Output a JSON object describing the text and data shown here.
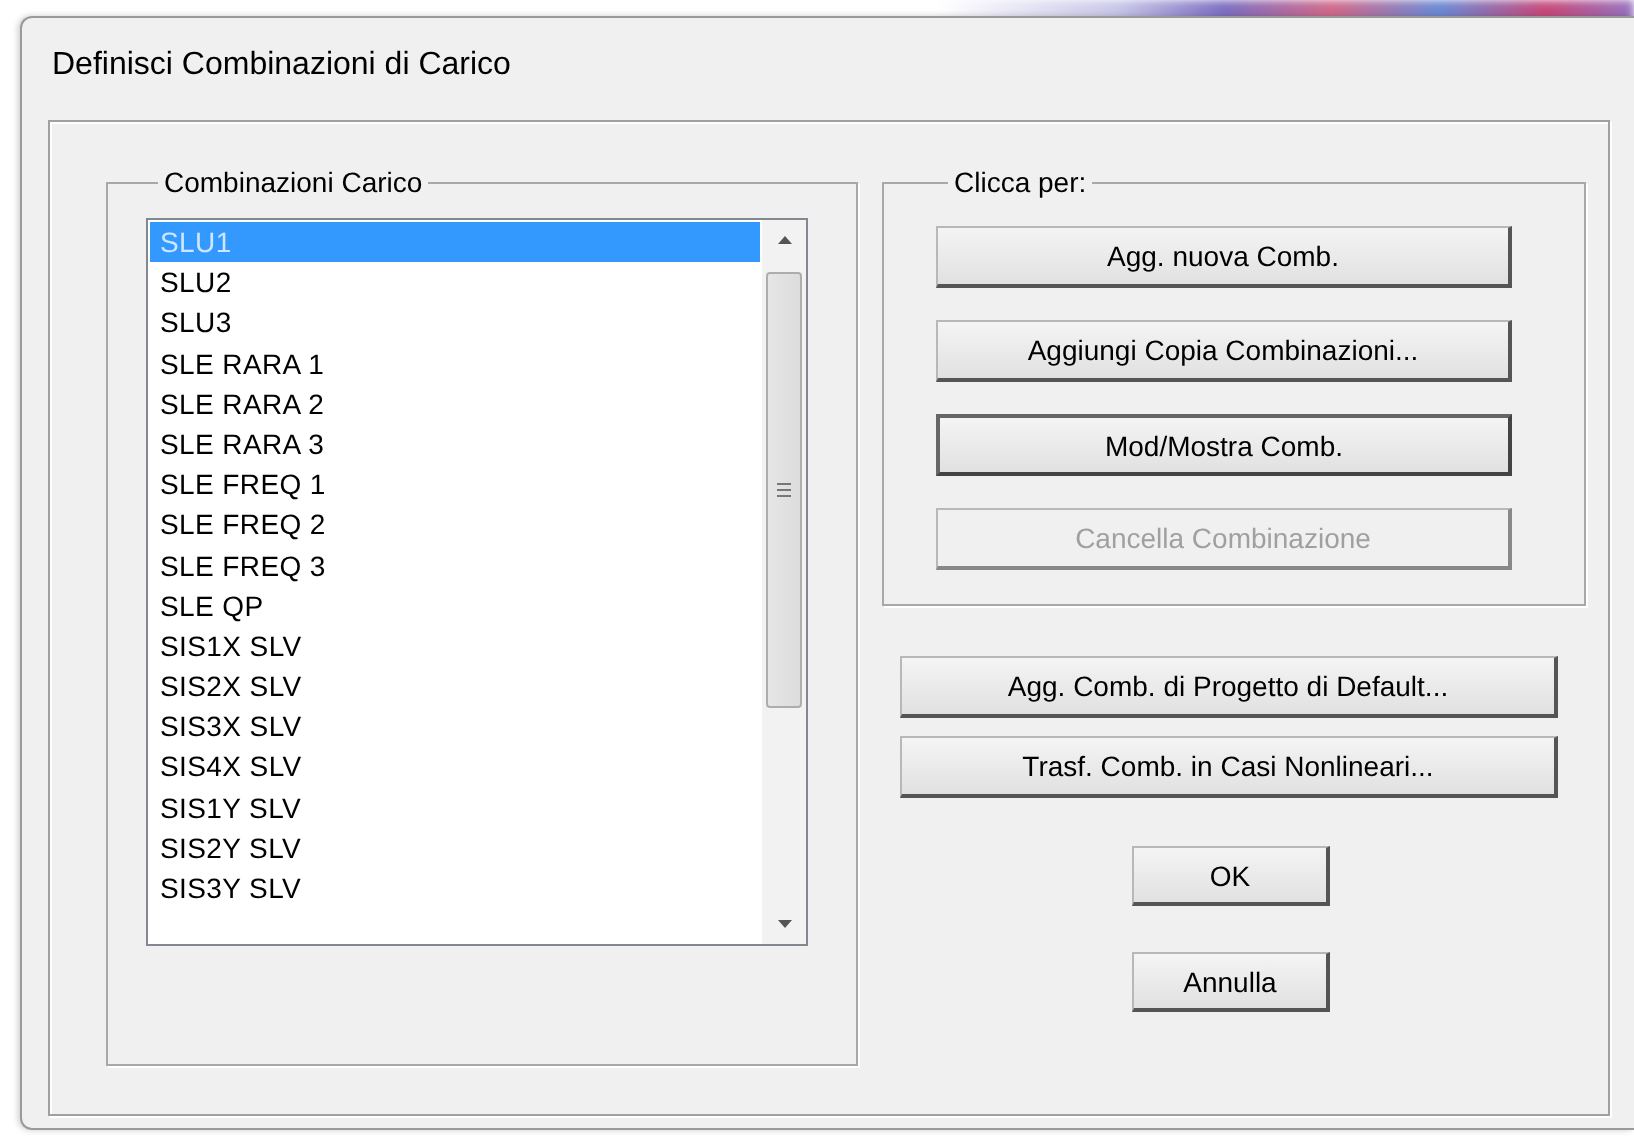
{
  "window": {
    "title": "Definisci Combinazioni di Carico"
  },
  "combinations": {
    "title": "Combinazioni Carico",
    "items": [
      {
        "label": "SLU1",
        "selected": true
      },
      {
        "label": "SLU2",
        "selected": false
      },
      {
        "label": "SLU3",
        "selected": false
      },
      {
        "label": "SLE RARA 1",
        "selected": false
      },
      {
        "label": "SLE RARA 2",
        "selected": false
      },
      {
        "label": "SLE RARA 3",
        "selected": false
      },
      {
        "label": "SLE FREQ 1",
        "selected": false
      },
      {
        "label": "SLE FREQ 2",
        "selected": false
      },
      {
        "label": "SLE FREQ 3",
        "selected": false
      },
      {
        "label": "SLE QP",
        "selected": false
      },
      {
        "label": "SIS1X SLV",
        "selected": false
      },
      {
        "label": "SIS2X SLV",
        "selected": false
      },
      {
        "label": "SIS3X SLV",
        "selected": false
      },
      {
        "label": "SIS4X SLV",
        "selected": false
      },
      {
        "label": "SIS1Y SLV",
        "selected": false
      },
      {
        "label": "SIS2Y SLV",
        "selected": false
      },
      {
        "label": "SIS3Y SLV",
        "selected": false
      }
    ]
  },
  "actions": {
    "title": "Clicca per:",
    "buttons": [
      {
        "label": "Agg. nuova Comb.",
        "disabled": false,
        "focused": false
      },
      {
        "label": "Aggiungi Copia Combinazioni...",
        "disabled": false,
        "focused": false
      },
      {
        "label": "Mod/Mostra Comb.",
        "disabled": false,
        "focused": true
      },
      {
        "label": "Cancella Combinazione",
        "disabled": true,
        "focused": false
      }
    ]
  },
  "extra_buttons": [
    {
      "label": "Agg. Comb. di Progetto di Default...",
      "disabled": false,
      "focused": false
    },
    {
      "label": "Trasf. Comb. in Casi Nonlineari...",
      "disabled": false,
      "focused": false
    }
  ],
  "dialog_buttons": [
    {
      "label": "OK",
      "disabled": false,
      "focused": false
    },
    {
      "label": "Annulla",
      "disabled": false,
      "focused": false
    }
  ]
}
